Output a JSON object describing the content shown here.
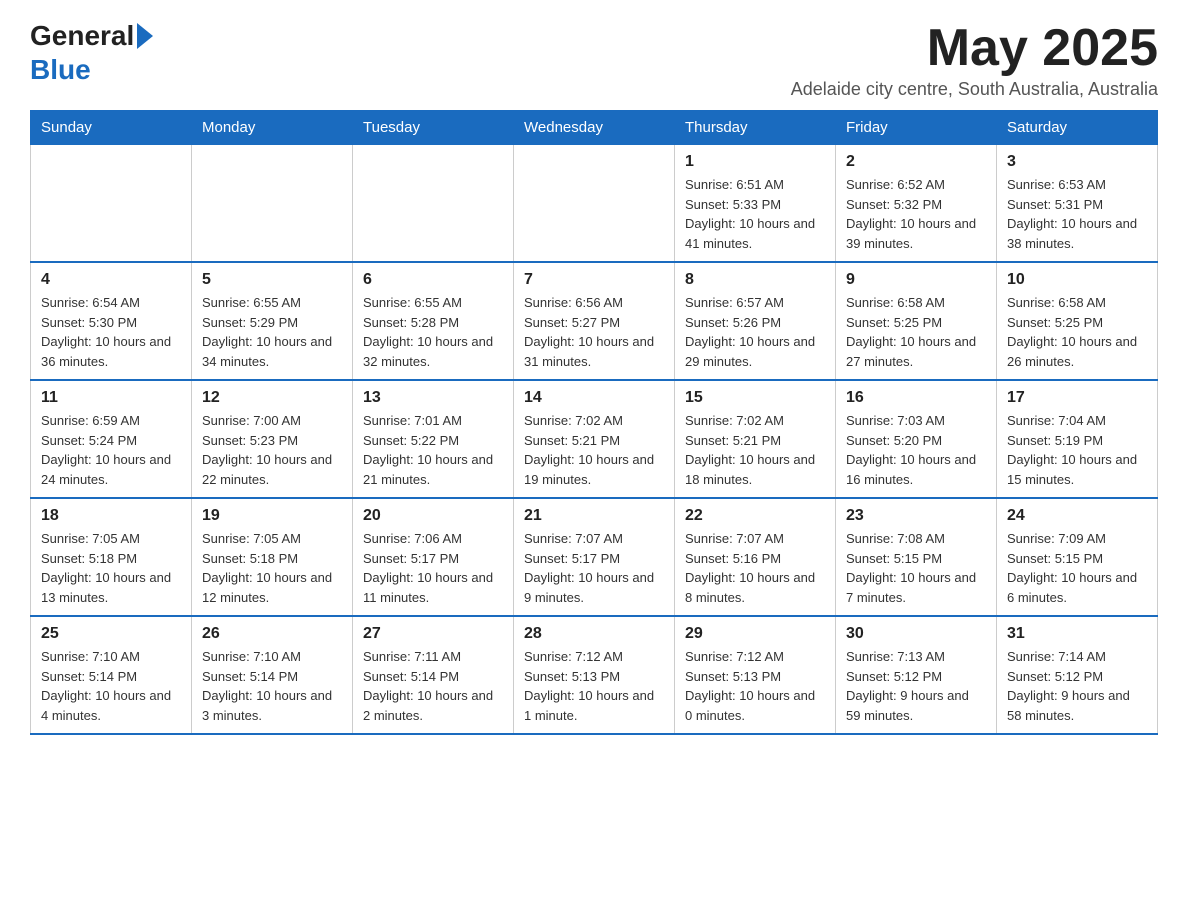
{
  "header": {
    "logo_general": "General",
    "logo_blue": "Blue",
    "title": "May 2025",
    "subtitle": "Adelaide city centre, South Australia, Australia"
  },
  "calendar": {
    "days_of_week": [
      "Sunday",
      "Monday",
      "Tuesday",
      "Wednesday",
      "Thursday",
      "Friday",
      "Saturday"
    ],
    "weeks": [
      [
        {
          "day": "",
          "info": ""
        },
        {
          "day": "",
          "info": ""
        },
        {
          "day": "",
          "info": ""
        },
        {
          "day": "",
          "info": ""
        },
        {
          "day": "1",
          "info": "Sunrise: 6:51 AM\nSunset: 5:33 PM\nDaylight: 10 hours and 41 minutes."
        },
        {
          "day": "2",
          "info": "Sunrise: 6:52 AM\nSunset: 5:32 PM\nDaylight: 10 hours and 39 minutes."
        },
        {
          "day": "3",
          "info": "Sunrise: 6:53 AM\nSunset: 5:31 PM\nDaylight: 10 hours and 38 minutes."
        }
      ],
      [
        {
          "day": "4",
          "info": "Sunrise: 6:54 AM\nSunset: 5:30 PM\nDaylight: 10 hours and 36 minutes."
        },
        {
          "day": "5",
          "info": "Sunrise: 6:55 AM\nSunset: 5:29 PM\nDaylight: 10 hours and 34 minutes."
        },
        {
          "day": "6",
          "info": "Sunrise: 6:55 AM\nSunset: 5:28 PM\nDaylight: 10 hours and 32 minutes."
        },
        {
          "day": "7",
          "info": "Sunrise: 6:56 AM\nSunset: 5:27 PM\nDaylight: 10 hours and 31 minutes."
        },
        {
          "day": "8",
          "info": "Sunrise: 6:57 AM\nSunset: 5:26 PM\nDaylight: 10 hours and 29 minutes."
        },
        {
          "day": "9",
          "info": "Sunrise: 6:58 AM\nSunset: 5:25 PM\nDaylight: 10 hours and 27 minutes."
        },
        {
          "day": "10",
          "info": "Sunrise: 6:58 AM\nSunset: 5:25 PM\nDaylight: 10 hours and 26 minutes."
        }
      ],
      [
        {
          "day": "11",
          "info": "Sunrise: 6:59 AM\nSunset: 5:24 PM\nDaylight: 10 hours and 24 minutes."
        },
        {
          "day": "12",
          "info": "Sunrise: 7:00 AM\nSunset: 5:23 PM\nDaylight: 10 hours and 22 minutes."
        },
        {
          "day": "13",
          "info": "Sunrise: 7:01 AM\nSunset: 5:22 PM\nDaylight: 10 hours and 21 minutes."
        },
        {
          "day": "14",
          "info": "Sunrise: 7:02 AM\nSunset: 5:21 PM\nDaylight: 10 hours and 19 minutes."
        },
        {
          "day": "15",
          "info": "Sunrise: 7:02 AM\nSunset: 5:21 PM\nDaylight: 10 hours and 18 minutes."
        },
        {
          "day": "16",
          "info": "Sunrise: 7:03 AM\nSunset: 5:20 PM\nDaylight: 10 hours and 16 minutes."
        },
        {
          "day": "17",
          "info": "Sunrise: 7:04 AM\nSunset: 5:19 PM\nDaylight: 10 hours and 15 minutes."
        }
      ],
      [
        {
          "day": "18",
          "info": "Sunrise: 7:05 AM\nSunset: 5:18 PM\nDaylight: 10 hours and 13 minutes."
        },
        {
          "day": "19",
          "info": "Sunrise: 7:05 AM\nSunset: 5:18 PM\nDaylight: 10 hours and 12 minutes."
        },
        {
          "day": "20",
          "info": "Sunrise: 7:06 AM\nSunset: 5:17 PM\nDaylight: 10 hours and 11 minutes."
        },
        {
          "day": "21",
          "info": "Sunrise: 7:07 AM\nSunset: 5:17 PM\nDaylight: 10 hours and 9 minutes."
        },
        {
          "day": "22",
          "info": "Sunrise: 7:07 AM\nSunset: 5:16 PM\nDaylight: 10 hours and 8 minutes."
        },
        {
          "day": "23",
          "info": "Sunrise: 7:08 AM\nSunset: 5:15 PM\nDaylight: 10 hours and 7 minutes."
        },
        {
          "day": "24",
          "info": "Sunrise: 7:09 AM\nSunset: 5:15 PM\nDaylight: 10 hours and 6 minutes."
        }
      ],
      [
        {
          "day": "25",
          "info": "Sunrise: 7:10 AM\nSunset: 5:14 PM\nDaylight: 10 hours and 4 minutes."
        },
        {
          "day": "26",
          "info": "Sunrise: 7:10 AM\nSunset: 5:14 PM\nDaylight: 10 hours and 3 minutes."
        },
        {
          "day": "27",
          "info": "Sunrise: 7:11 AM\nSunset: 5:14 PM\nDaylight: 10 hours and 2 minutes."
        },
        {
          "day": "28",
          "info": "Sunrise: 7:12 AM\nSunset: 5:13 PM\nDaylight: 10 hours and 1 minute."
        },
        {
          "day": "29",
          "info": "Sunrise: 7:12 AM\nSunset: 5:13 PM\nDaylight: 10 hours and 0 minutes."
        },
        {
          "day": "30",
          "info": "Sunrise: 7:13 AM\nSunset: 5:12 PM\nDaylight: 9 hours and 59 minutes."
        },
        {
          "day": "31",
          "info": "Sunrise: 7:14 AM\nSunset: 5:12 PM\nDaylight: 9 hours and 58 minutes."
        }
      ]
    ]
  }
}
